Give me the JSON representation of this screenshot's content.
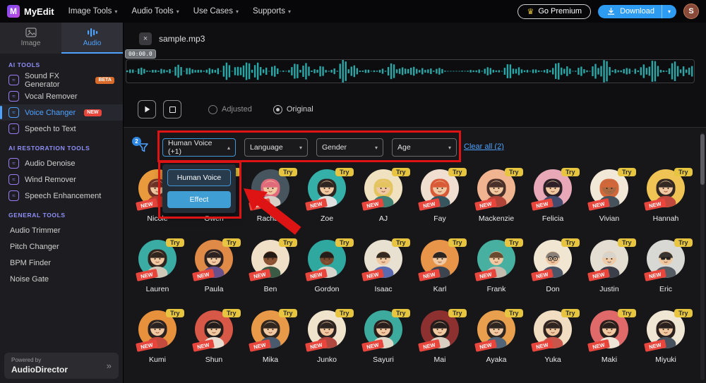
{
  "navbar": {
    "logo_mark": "M",
    "logo_text": "MyEdit",
    "menus": [
      {
        "label": "Image Tools"
      },
      {
        "label": "Audio Tools"
      },
      {
        "label": "Use Cases"
      },
      {
        "label": "Supports"
      }
    ],
    "premium_label": "Go Premium",
    "download_label": "Download",
    "account_initial": "S"
  },
  "sidebar": {
    "tabs": [
      {
        "label": "Image",
        "active": false
      },
      {
        "label": "Audio",
        "active": true
      }
    ],
    "sections": [
      {
        "title": "AI TOOLS",
        "icons": true,
        "items": [
          {
            "label": "Sound FX Generator",
            "badge": "BETA"
          },
          {
            "label": "Vocal Remover"
          },
          {
            "label": "Voice Changer",
            "badge": "NEW",
            "active": true
          },
          {
            "label": "Speech to Text"
          }
        ]
      },
      {
        "title": "AI RESTORATION TOOLS",
        "icons": true,
        "items": [
          {
            "label": "Audio Denoise"
          },
          {
            "label": "Wind Remover"
          },
          {
            "label": "Speech Enhancement"
          }
        ]
      },
      {
        "title": "GENERAL TOOLS",
        "icons": false,
        "items": [
          {
            "label": "Audio Trimmer"
          },
          {
            "label": "Pitch Changer"
          },
          {
            "label": "BPM Finder"
          },
          {
            "label": "Noise Gate"
          }
        ]
      }
    ],
    "footer": {
      "powered_by": "Powered by",
      "brand": "AudioDirector"
    }
  },
  "player": {
    "file_name": "sample.mp3",
    "timestamp": "00:00.0",
    "radio_adjusted": "Adjusted",
    "radio_original": "Original",
    "original_selected": true
  },
  "filters": {
    "badge_count": "2",
    "dropdowns": [
      {
        "label": "Human Voice (+1)",
        "active": true
      },
      {
        "label": "Language"
      },
      {
        "label": "Gender"
      },
      {
        "label": "Age"
      }
    ],
    "clear_all": "Clear all (2)",
    "menu_options": [
      {
        "label": "Human Voice",
        "selected": true
      },
      {
        "label": "Effect"
      }
    ]
  },
  "voices": {
    "try_label": "Try",
    "new_label": "NEW",
    "rows": [
      [
        {
          "n": "Nicole",
          "bg": "#e89a3c",
          "hair": "#6e3428",
          "long": true,
          "shirt": "#b43f35"
        },
        {
          "n": "Owen",
          "bg": "#7fb69a",
          "hair": "#c2622f",
          "long": false,
          "shirt": "#4d6b5a"
        },
        {
          "n": "Rachael",
          "bg": "#46555e",
          "hair": "#e0697a",
          "long": true,
          "shirt": "#d8d0c8"
        },
        {
          "n": "Zoe",
          "bg": "#35b0a8",
          "hair": "#2e2420",
          "long": true,
          "shirt": "#e0e0e0"
        },
        {
          "n": "AJ",
          "bg": "#f0e2c0",
          "hair": "#e3c45e",
          "long": true,
          "shirt": "#3f7f74"
        },
        {
          "n": "Fay",
          "bg": "#f0ded0",
          "hair": "#d85a36",
          "long": true,
          "shirt": "#37555e"
        },
        {
          "n": "Mackenzie",
          "bg": "#f0b490",
          "hair": "#4a302a",
          "long": true,
          "shirt": "#b04438"
        },
        {
          "n": "Felicia",
          "bg": "#e8a8b8",
          "hair": "#2c2026",
          "long": true,
          "shirt": "#424a6e"
        },
        {
          "n": "Vivian",
          "bg": "#f2e8d8",
          "hair": "#d2683a",
          "long": true,
          "shirt": "#46525c",
          "skin": "#a96a42"
        },
        {
          "n": "Hannah",
          "bg": "#f0c454",
          "hair": "#332822",
          "long": true,
          "shirt": "#c0483c"
        }
      ],
      [
        {
          "n": "Lauren",
          "bg": "#3aaca4",
          "hair": "#30241e",
          "long": true,
          "shirt": "#d0c8b8"
        },
        {
          "n": "Paula",
          "bg": "#e08a48",
          "hair": "#2e2220",
          "long": true,
          "shirt": "#68508c"
        },
        {
          "n": "Ben",
          "bg": "#f0e0c8",
          "hair": "#241a14",
          "long": false,
          "shirt": "#3a5a46",
          "skin": "#8a5434"
        },
        {
          "n": "Gordon",
          "bg": "#2fa8a0",
          "hair": "#241c18",
          "long": false,
          "shirt": "#d8d4cc",
          "skin": "#7a4a2e"
        },
        {
          "n": "Isaac",
          "bg": "#e8e0d0",
          "hair": "#342a22",
          "long": false,
          "shirt": "#5a6ab0"
        },
        {
          "n": "Karl",
          "bg": "#e8954a",
          "hair": "#2c241e",
          "long": false,
          "shirt": "#3c4450"
        },
        {
          "n": "Frank",
          "bg": "#48b0a0",
          "hair": "#6a4a2e",
          "long": false,
          "shirt": "#c4bcae"
        },
        {
          "n": "Don",
          "bg": "#f0e6d2",
          "hair": "#8a8078",
          "long": false,
          "feat": "glasses",
          "shirt": "#4a5568"
        },
        {
          "n": "Justin",
          "bg": "#e4ded2",
          "hair": "#d8d4cc",
          "long": false,
          "feat": "beard",
          "shirt": "#3a3f4a"
        },
        {
          "n": "Eric",
          "bg": "#d8d8d4",
          "hair": "#3a3430",
          "long": false,
          "feat": "sunglasses",
          "shirt": "#565c64"
        }
      ],
      [
        {
          "n": "Kumi",
          "bg": "#e8913c",
          "hair": "#2a2220",
          "long": true,
          "shirt": "#c44a3e"
        },
        {
          "n": "Shun",
          "bg": "#d85848",
          "hair": "#241c1a",
          "long": true,
          "shirt": "#e8ddd0"
        },
        {
          "n": "Mika",
          "bg": "#e89a48",
          "hair": "#30261e",
          "long": true,
          "shirt": "#4a5a6e"
        },
        {
          "n": "Junko",
          "bg": "#f0e4cc",
          "hair": "#2c2220",
          "long": true,
          "shirt": "#b04840"
        },
        {
          "n": "Sayuri",
          "bg": "#3cab9e",
          "hair": "#281f1c",
          "long": true,
          "shirt": "#e0d8c8"
        },
        {
          "n": "Mai",
          "bg": "#8c3030",
          "hair": "#241c1a",
          "long": true,
          "shirt": "#d8cfc2"
        },
        {
          "n": "Ayaka",
          "bg": "#e8a04e",
          "hair": "#2e2420",
          "long": true,
          "shirt": "#50657a"
        },
        {
          "n": "Yuka",
          "bg": "#f0ddc2",
          "hair": "#302420",
          "long": true,
          "shirt": "#c8564a"
        },
        {
          "n": "Maki",
          "bg": "#e06a6a",
          "hair": "#281e1c",
          "long": true,
          "shirt": "#ece4d6"
        },
        {
          "n": "Miyuki",
          "bg": "#efe6d4",
          "hair": "#2a211e",
          "long": true,
          "shirt": "#46525e"
        }
      ]
    ]
  },
  "colors": {
    "accent_blue": "#4da3ff",
    "waveform": "#2aa6a6",
    "annotation_red": "#de1414",
    "try_badge": "#e7c53e",
    "new_badge": "#e8453c"
  }
}
